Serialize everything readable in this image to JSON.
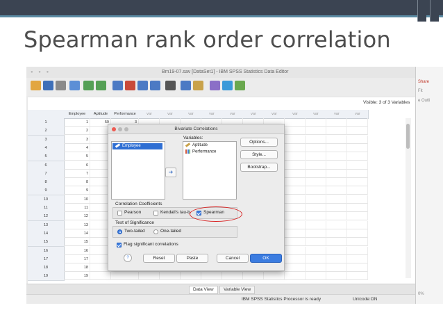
{
  "slide": {
    "title": "Spearman rank order correlation"
  },
  "window": {
    "title": "Bm19-07.sav [DataSet1] - IBM SPSS Statistics Data Editor"
  },
  "right_panel": {
    "items": [
      "Share",
      "Fit",
      "e Outli",
      "0%"
    ]
  },
  "sheet": {
    "visible_text": "Visible: 3 of 3 Variables",
    "columns": [
      "Employee",
      "Aptitude",
      "Performance",
      "var",
      "var",
      "var",
      "var",
      "var",
      "var",
      "var",
      "var",
      "var",
      "var",
      "var"
    ],
    "rows": [
      "1",
      "2",
      "3",
      "4",
      "5",
      "6",
      "7",
      "8",
      "9",
      "10",
      "11",
      "12",
      "13",
      "14",
      "15",
      "16",
      "17",
      "18",
      "19"
    ],
    "employee_values": [
      "1",
      "2",
      "3",
      "4",
      "5",
      "6",
      "7",
      "8",
      "9",
      "10",
      "11",
      "12",
      "13",
      "14",
      "15",
      "16",
      "17",
      "18",
      "19"
    ],
    "aptitude_values": [
      "59",
      "",
      "",
      "",
      "",
      "",
      "",
      "",
      "",
      "",
      "",
      "",
      "",
      "",
      "",
      "",
      "",
      "",
      ""
    ],
    "performance_values": [
      "3",
      "",
      "",
      "",
      "",
      "",
      "",
      "",
      "",
      "",
      "",
      "",
      "",
      "",
      "",
      "",
      "",
      "",
      ""
    ]
  },
  "tabs": {
    "data_view": "Data View",
    "variable_view": "Variable View"
  },
  "status": {
    "processor": "IBM SPSS Statistics Processor is ready",
    "unicode": "Unicode:ON"
  },
  "dialog": {
    "title": "Bivariate Correlations",
    "source_list": [
      "Employee"
    ],
    "variables_label": "Variables:",
    "variables_list": [
      "Aptitude",
      "Performance"
    ],
    "buttons": {
      "options": "Options...",
      "style": "Style...",
      "bootstrap": "Bootstrap..."
    },
    "coefficients": {
      "label": "Correlation Coefficients",
      "pearson": "Pearson",
      "kendall": "Kendall's tau-b",
      "spearman": "Spearman",
      "pearson_checked": false,
      "kendall_checked": false,
      "spearman_checked": true
    },
    "significance": {
      "label": "Test of Significance",
      "two_tailed": "Two-tailed",
      "one_tailed": "One-tailed",
      "selected": "Two-tailed"
    },
    "flag": {
      "label": "Flag significant correlations",
      "checked": true
    },
    "footer": {
      "help": "?",
      "reset": "Reset",
      "paste": "Paste",
      "cancel": "Cancel",
      "ok": "OK"
    }
  }
}
